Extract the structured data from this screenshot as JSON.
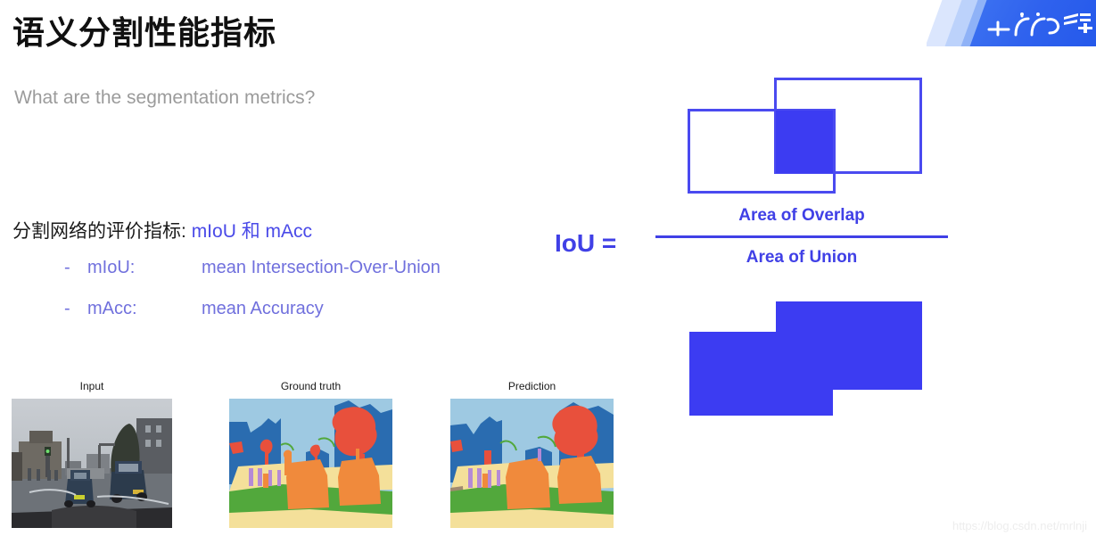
{
  "header": {
    "title": "语义分割性能指标",
    "subtitle": "What are the segmentation metrics?",
    "logo_name": "paddlepaddle-feijiang-logo"
  },
  "body": {
    "metric_intro": "分割网络的评价指标:",
    "metric_highlight": "mIoU 和 mAcc",
    "bullets": [
      {
        "dash": "-",
        "key": "mIoU:",
        "value": "mean Intersection-Over-Union"
      },
      {
        "dash": "-",
        "key": "mAcc:",
        "value": "mean Accuracy"
      }
    ]
  },
  "formula": {
    "lhs": "IoU =",
    "numerator": "Area of Overlap",
    "denominator": "Area of Union"
  },
  "samples": [
    {
      "caption": "Input"
    },
    {
      "caption": "Ground truth"
    },
    {
      "caption": "Prediction"
    }
  ],
  "watermark": "https://blog.csdn.net/mrlnji",
  "colors": {
    "accent_blue": "#3c3cf2",
    "text_blue": "#4a4ae8",
    "bullet_blue": "#7070dd",
    "subtitle_gray": "#9b9b9b",
    "logo_blue": "#2f62ee"
  }
}
